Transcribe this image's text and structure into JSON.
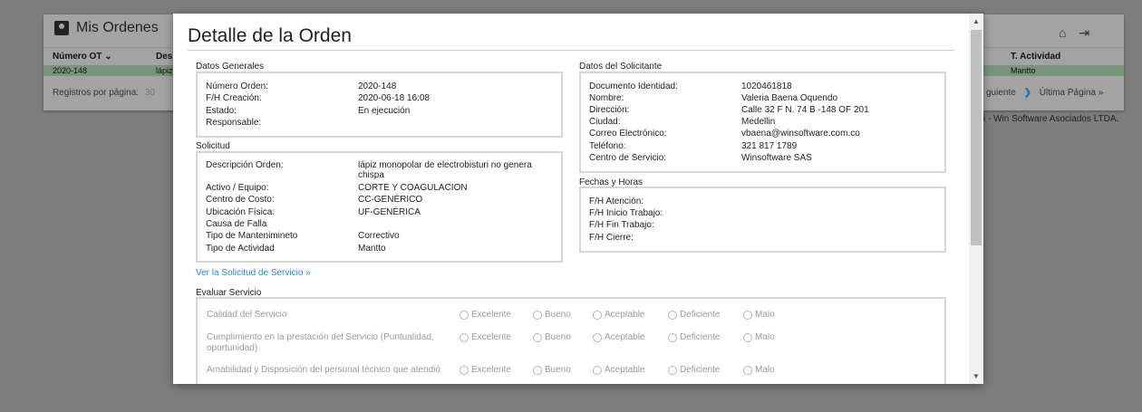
{
  "background": {
    "title": "Mis Ordenes",
    "col_ot": "Número OT",
    "col_desc": "Des",
    "col_tact": "T. Actividad",
    "row_ot": "2020-148",
    "row_desc": "lápiz",
    "row_tact": "Mantto",
    "per_page_label": "Registros por página:",
    "per_page_value": "30",
    "next_label": "guiente",
    "last_label": "Última Página »",
    "copyright": "si - Win Software Asociados LTDA.",
    "home_icon": "home-icon",
    "logout_icon": "logout-icon"
  },
  "modal": {
    "title": "Detalle de la Orden",
    "datos_generales": {
      "label": "Datos Generales",
      "numero_orden_k": "Número Orden:",
      "numero_orden_v": "2020-148",
      "creacion_k": "F/H Creación:",
      "creacion_v": "2020-06-18 16:08",
      "estado_k": "Estado:",
      "estado_v": "En ejecución",
      "responsable_k": "Responsable:",
      "responsable_v": ""
    },
    "solicitud": {
      "label": "Solicitud",
      "descripcion_k": "Descripción Orden:",
      "descripcion_v": "lápiz monopolar de electrobisturi no genera chispa",
      "activo_k": "Activo / Equipo:",
      "activo_v": "CORTE Y COAGULACION",
      "centro_k": "Centro de Costo:",
      "centro_v": "CC-GENÉRICO",
      "ubicacion_k": "Ubicación Física:",
      "ubicacion_v": "UF-GENÉRICA",
      "causa_k": "Causa de Falla",
      "causa_v": "",
      "tipo_mant_k": "Tipo de Mantenimineto",
      "tipo_mant_v": "Correctivo",
      "tipo_act_k": "Tipo de Actividad",
      "tipo_act_v": "Mantto"
    },
    "solicitante": {
      "label": "Datos del Solicitante",
      "documento_k": "Documento Identidad:",
      "documento_v": "1020461818",
      "nombre_k": "Nombre:",
      "nombre_v": "Valeria Baena Oquendo",
      "direccion_k": "Dirección:",
      "direccion_v": "Calle 32 F N. 74 B -148 OF 201",
      "ciudad_k": "Ciudad:",
      "ciudad_v": "Medellin",
      "correo_k": "Correo Electrónico:",
      "correo_v": "vbaena@winsoftware.com.co",
      "telefono_k": "Teléfono:",
      "telefono_v": "321 817 1789",
      "centro_servicio_k": "Centro de Servicio:",
      "centro_servicio_v": "Winsoftware SAS"
    },
    "fechas": {
      "label": "Fechas y Horas",
      "atencion_k": "F/H Atención:",
      "inicio_k": "F/H Inicio Trabajo:",
      "fin_k": "F/H Fin Trabajo:",
      "cierre_k": "F/H Cierre:"
    },
    "link_solicitud": "Ver la Solicitud de Servicio »",
    "evaluar": {
      "label": "Evaluar Servicio",
      "options": [
        "Excelente",
        "Bueno",
        "Aceptable",
        "Deficiente",
        "Malo"
      ],
      "questions": [
        "Calidad del Servicio",
        "Cumplimiento en la prestación del Servicio (Puntualidad, oportunidad)",
        "Amabilidad y Disposición del personal técnico que atendió"
      ]
    }
  }
}
